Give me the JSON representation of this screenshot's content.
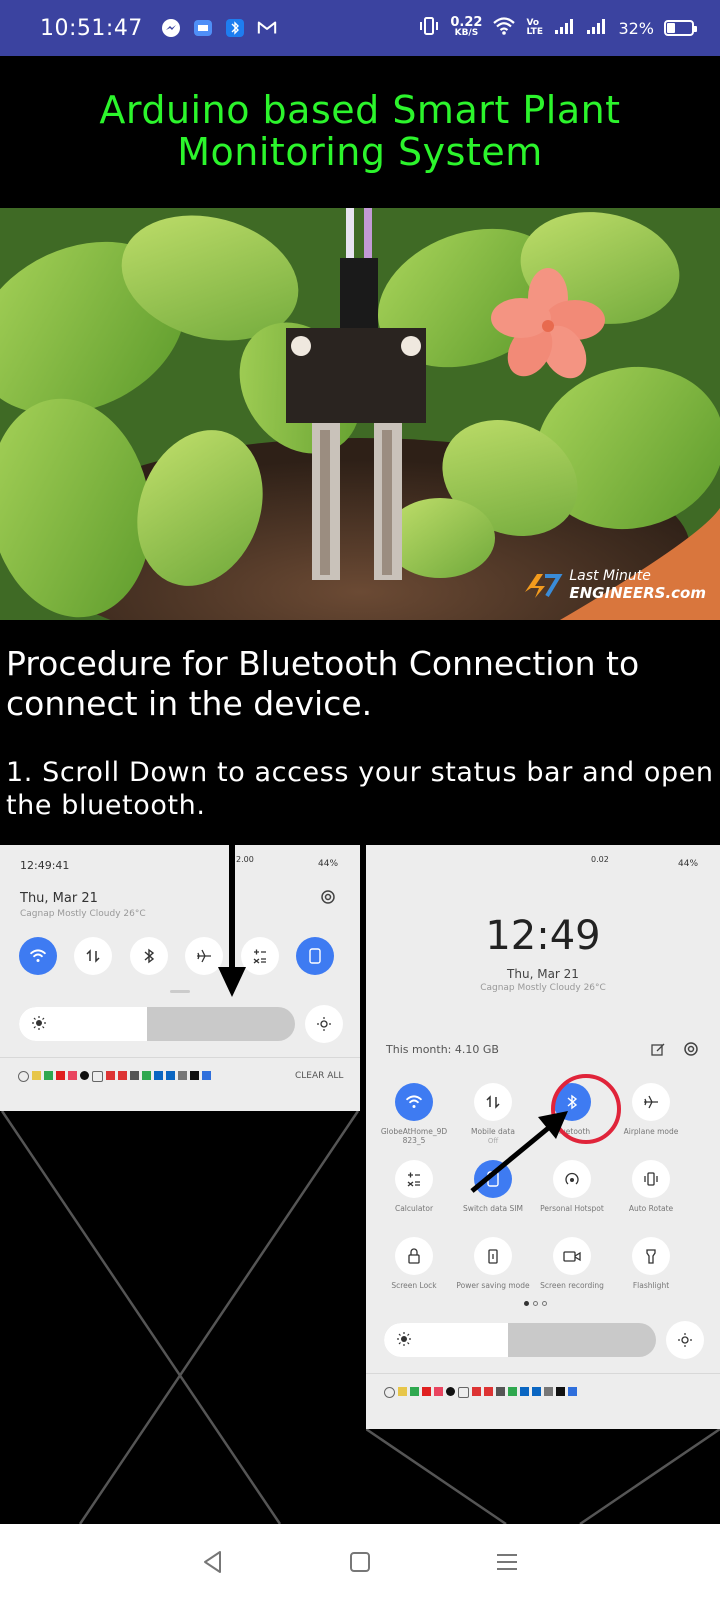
{
  "status_bar": {
    "time": "10:51:47",
    "net_speed_value": "0.22",
    "net_speed_unit": "KB/S",
    "volte": "Vo LTE",
    "battery_text": "32%",
    "battery_level": 0.32,
    "left_icons": [
      "messenger-icon",
      "message-icon",
      "bluetooth-notification-icon",
      "gmail-icon"
    ],
    "right_icons": [
      "vibrate-icon",
      "wifi-icon",
      "signal-icon",
      "signal-icon",
      "battery-icon"
    ]
  },
  "page": {
    "title": "Arduino based Smart Plant Monitoring System",
    "hero_brand_line1": "Last Minute",
    "hero_brand_line2": "ENGINEERS.com",
    "section_heading": "Procedure for Bluetooth Connection to connect in the device.",
    "step_1": "1. Scroll Down to access your status bar and open the bluetooth."
  },
  "screenshot_left": {
    "time": "12:49:41",
    "speed": "2.00",
    "battery": "44%",
    "date": "Thu, Mar 21",
    "weather": "Cagnap Mostly Cloudy 26°C",
    "clear_all": "CLEAR ALL"
  },
  "screenshot_right": {
    "speed": "0.02",
    "battery": "44%",
    "clock": "12:49",
    "date": "Thu, Mar 21",
    "weather": "Cagnap Mostly Cloudy 26°C",
    "data_usage": "This month: 4.10 GB",
    "tiles": [
      {
        "label": "GlobeAtHome_9D 823_5",
        "on": true
      },
      {
        "label": "Mobile data",
        "sub": "Off",
        "on": false
      },
      {
        "label": "Bluetooth",
        "on": true
      },
      {
        "label": "Airplane mode",
        "on": false
      },
      {
        "label": "Calculator",
        "on": false
      },
      {
        "label": "Switch data SIM",
        "on": true
      },
      {
        "label": "Personal Hotspot",
        "on": false
      },
      {
        "label": "Auto Rotate",
        "on": false
      },
      {
        "label": "Screen Lock",
        "on": false
      },
      {
        "label": "Power saving mode",
        "on": false
      },
      {
        "label": "Screen recording",
        "on": false
      },
      {
        "label": "Flashlight",
        "on": false
      }
    ]
  },
  "nav": {
    "back": "back-button",
    "home": "home-button",
    "menu": "recents-button"
  },
  "colors": {
    "status_bar_bg": "#3b43a0",
    "title_green": "#2cf52c",
    "accent_blue": "#3e7bf2",
    "highlight_red": "#e0243a"
  }
}
